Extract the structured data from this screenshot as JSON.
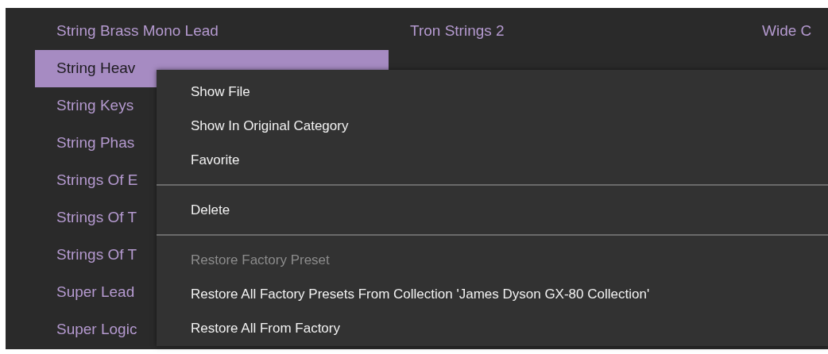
{
  "columns": [
    {
      "items": [
        {
          "label": "String Brass Mono Lead",
          "selected": false
        },
        {
          "label": "String Heav",
          "selected": true
        },
        {
          "label": "String Keys",
          "selected": false
        },
        {
          "label": "String Phas",
          "selected": false
        },
        {
          "label": "Strings Of E",
          "selected": false
        },
        {
          "label": "Strings Of T",
          "selected": false
        },
        {
          "label": "Strings Of T",
          "selected": false
        },
        {
          "label": "Super Lead",
          "selected": false
        },
        {
          "label": "Super Logic",
          "selected": false
        }
      ]
    },
    {
      "items": [
        {
          "label": "Tron Strings 2",
          "selected": false
        }
      ]
    },
    {
      "items": [
        {
          "label": "Wide C",
          "selected": false
        }
      ]
    }
  ],
  "context_menu": {
    "items": [
      {
        "kind": "item",
        "label": "Show File",
        "disabled": false
      },
      {
        "kind": "item",
        "label": "Show In Original Category",
        "disabled": false
      },
      {
        "kind": "item",
        "label": "Favorite",
        "disabled": false
      },
      {
        "kind": "separator"
      },
      {
        "kind": "item",
        "label": "Delete",
        "disabled": false
      },
      {
        "kind": "separator"
      },
      {
        "kind": "item",
        "label": "Restore Factory Preset",
        "disabled": true
      },
      {
        "kind": "item",
        "label": "Restore All Factory Presets From Collection 'James Dyson GX-80 Collection'",
        "disabled": false
      },
      {
        "kind": "item",
        "label": "Restore All From Factory",
        "disabled": false
      }
    ]
  }
}
